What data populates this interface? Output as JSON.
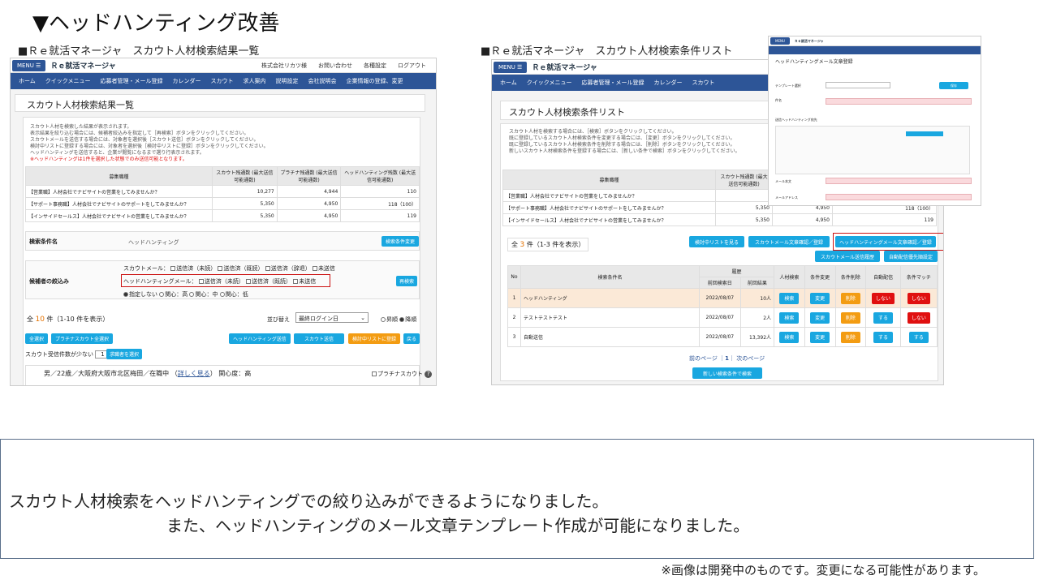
{
  "slide_title": "▼ヘッドハンティング改善",
  "left_caption": "■Ｒｅ就活マネージャ　スカウト人材検索結果一覧",
  "right_caption": "■Ｒｅ就活マネージャ　スカウト人材検索条件リスト",
  "app": {
    "menu_label": "MENU",
    "logo": "Ｒｅ就活マネージャ",
    "top_links": [
      "株式会社リカツ様",
      "お問い合わせ",
      "各種設定",
      "ログアウト"
    ],
    "nav_items": [
      "ホーム",
      "クイックメニュー",
      "応募者管理・メール登録",
      "カレンダー",
      "スカウト",
      "求人案内",
      "説明設定",
      "会社説明会",
      "企業情報の登録、変更"
    ]
  },
  "left": {
    "page_title": "スカウト人材検索結果一覧",
    "desc_lines": [
      "スカウト人材を検索した結果が表示されます。",
      "表示結果を絞り込む場合には、候補者絞込みを指定して［再検索］ボタンをクリックしてください。",
      "スカウトメールを送信する場合には、対象者を選択後［スカウト送信］ボタンをクリックしてください。",
      "検討中リストに登録する場合には、対象者を選択後［検討中リストに登録］ボタンをクリックしてください。",
      "ヘッドハンティングを送信すると、企業が閲覧になるまで選り行表示されます。"
    ],
    "warning": "※ヘッドハンティングは1件を選択した状態でのみ送信可能となります。",
    "table_headers": [
      "募集職種",
      "スカウト残通数\n(最大送信可能通数)",
      "プラチナ残通数\n(最大送信可能通数)",
      "ヘッドハンティング残数\n(最大送信可能通数)"
    ],
    "rows": [
      [
        "【営業職】人材会社でナビサイトの営業をしてみませんか？",
        "10,277",
        "4,944",
        "110"
      ],
      [
        "【サポート事務職】人材会社でナビサイトのサポートをしてみませんか？",
        "5,350",
        "4,950",
        "118（100）"
      ],
      [
        "【インサイドセールス】人材会社でナビサイトの営業をしてみませんか？",
        "5,350",
        "4,950",
        "119"
      ]
    ],
    "cond_label": "検索条件名",
    "cond_value": "ヘッドハンティング",
    "cond_change_btn": "検索条件変更",
    "filter_label": "候補者の絞込み",
    "scout_mail_label": "スカウトメール：",
    "scout_opts": [
      "送信済（未読）",
      "送信済（既読）",
      "送信済（辞退）",
      "未送信"
    ],
    "hh_mail_label": "ヘッドハンティングメール：",
    "hh_opts": [
      "送信済（未読）",
      "送信済（既読）",
      "未送信"
    ],
    "radio_opts": [
      "指定しない",
      "関心：高",
      "関心：中",
      "関心：低"
    ],
    "research_btn": "再検索",
    "count_prefix": "全",
    "count_num": "10",
    "count_suffix": "件（1-10 件を表示）",
    "sort_label": "並び替え",
    "sort_value": "最終ログイン日",
    "order_opts": [
      "昇順",
      "降順"
    ],
    "btn_all": "全選択",
    "btn_platinum_all": "プラチナスカウト全選択",
    "btn_hh_send": "ヘッドハンティング送信",
    "btn_scout_send": "スカウト送信",
    "btn_register": "検討中リストに登録",
    "btn_back": "戻る",
    "scout_count_label": "スカウト受信件数が少ない",
    "scout_count_value": "1",
    "scout_count_unit": "件の",
    "btn_select_candidates": "求職者を選択",
    "person_line": "男／22歳／大阪府大阪市北区梅田／在職中",
    "person_link": "詳しく見る",
    "person_interest": "関心度：高",
    "platinum_label": "プラチナスカウト"
  },
  "right": {
    "page_title": "スカウト人材検索条件リスト",
    "desc_lines": [
      "スカウト人材を検索する場合には、［検索］ボタンをクリックしてください。",
      "既に登録しているスカウト人材検索条件を変更する場合には、［変更］ボタンをクリックしてください。",
      "既に登録しているスカウト人材検索条件を削除する場合には、［削除］ボタンをクリックしてください。",
      "新しいスカウト人材検索条件を登録する場合には、［新しい条件で検索］ボタンをクリックしてください。"
    ],
    "table_header": "募集職種",
    "table_header2": "スカウト残通数\n(最大送信可能通数)",
    "rows": [
      [
        "【営業職】人材会社でナビサイトの営業をしてみませんか？",
        "",
        "",
        ""
      ],
      [
        "【サポート事務職】人材会社でナビサイトのサポートをしてみませんか？",
        "5,350",
        "4,950",
        "118（100）"
      ],
      [
        "【インサイドセールス】人材会社でナビサイトの営業をしてみませんか？",
        "5,350",
        "4,950",
        "119"
      ]
    ],
    "count_prefix": "全",
    "count_num": "3",
    "count_suffix": "件（1-3 件を表示）",
    "btn_review_list": "検討中リストを見る",
    "btn_scout_tpl": "スカウトメール文章確認／登録",
    "btn_hh_tpl": "ヘッドハンティングメール文章確認／登録",
    "btn_scout_history": "スカウトメール送信履歴",
    "btn_auto_settings": "自動配信優先順設定",
    "list_headers": [
      "No",
      "検索条件名",
      "履歴",
      "前回検索日",
      "前回結果",
      "人材検索",
      "条件変更",
      "条件削除",
      "自動配信",
      "条件マッチ"
    ],
    "list_rows": [
      {
        "no": "1",
        "name": "ヘッドハンティング",
        "date": "2022/08/07",
        "result": "10人",
        "auto": "しない",
        "match": "しない"
      },
      {
        "no": "2",
        "name": "テストテストテスト",
        "date": "2022/08/07",
        "result": "2人",
        "auto": "する",
        "match": "しない"
      },
      {
        "no": "3",
        "name": "自動送信",
        "date": "2022/08/07",
        "result": "13,392人",
        "auto": "する",
        "match": "する"
      }
    ],
    "btn_search": "検索",
    "btn_change": "変更",
    "btn_delete": "削除",
    "pager_prev": "前のページ",
    "pager_current": "1",
    "pager_next": "次のページ",
    "btn_new_search": "新しい検索条件で検索"
  },
  "overlay": {
    "title": "ヘッドハンティングメール文章登録",
    "template_label": "テンプレート選択",
    "save_btn": "保存",
    "subject_label": "件名",
    "sender_label": "送信ヘッドハンティング宛先",
    "body_label": "メール本文",
    "attach_label": "メールアドレス"
  },
  "message_line1": "スカウト人材検索をヘッドハンティングでの絞り込みができるようになりました。",
  "message_line2": "また、ヘッドハンティングのメール文章テンプレート作成が可能になりました。",
  "footnote": "※画像は開発中のものです。変更になる可能性があります。",
  "colors": {
    "nav": "#2d5597",
    "cyan_button": "#19a7e0",
    "orange_button": "#f39c12",
    "red_button": "#e01010",
    "highlight_row": "#fbe9d7"
  }
}
